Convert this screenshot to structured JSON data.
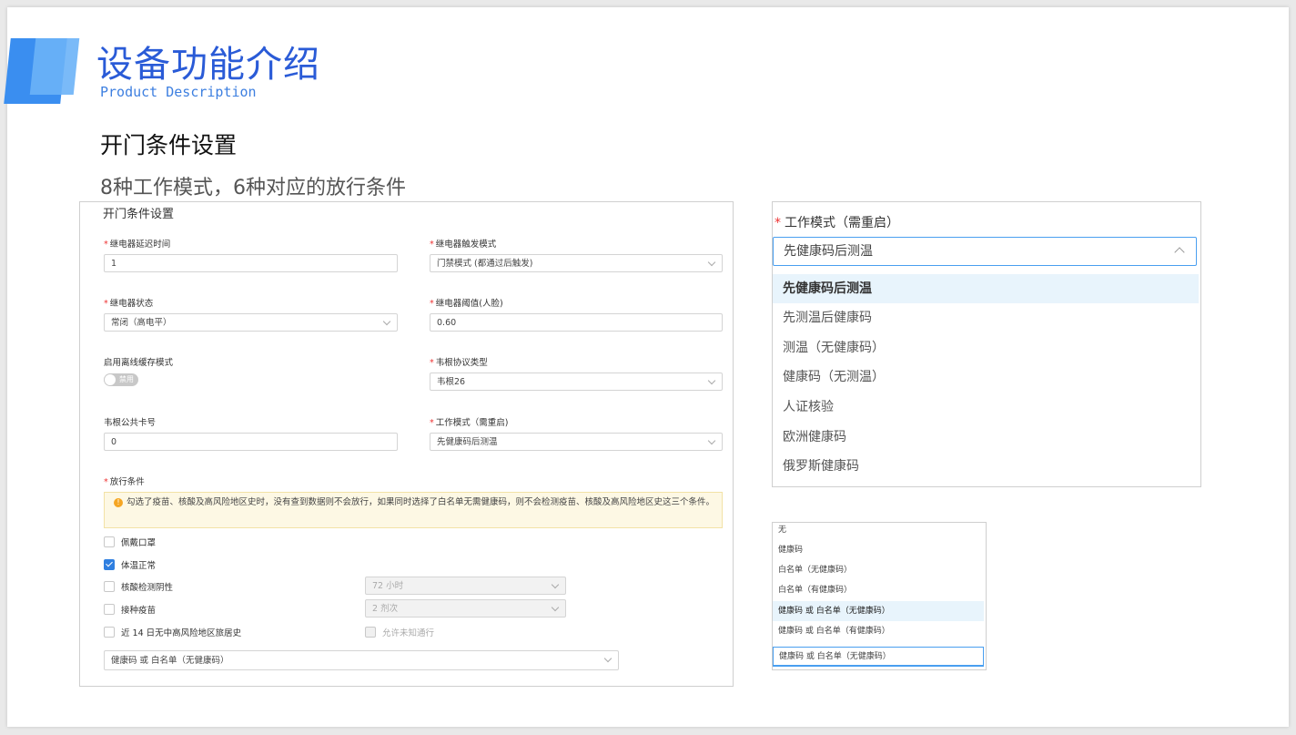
{
  "slide": {
    "title": "设备功能介绍",
    "subtitle": "Product Description",
    "heading": "开门条件设置",
    "subheading": "8种工作模式，6种对应的放行条件"
  },
  "form": {
    "title": "开门条件设置",
    "relay_delay": {
      "label": "继电器延迟时间",
      "value": "1"
    },
    "relay_trigger": {
      "label": "继电器触发模式",
      "value": "门禁模式 (都通过后触发)"
    },
    "relay_state": {
      "label": "继电器状态",
      "value": "常闭（高电平）"
    },
    "relay_threshold": {
      "label": "继电器阈值(人脸)",
      "value": "0.60"
    },
    "offline_cache": {
      "label": "启用离线缓存模式",
      "toggle_label": "禁用"
    },
    "wiegand_protocol": {
      "label": "韦根协议类型",
      "value": "韦根26"
    },
    "wiegand_card": {
      "label": "韦根公共卡号",
      "value": "0"
    },
    "work_mode": {
      "label": "工作模式（需重启",
      "value": "先健康码后测温"
    },
    "pass_conditions": {
      "label": "放行条件",
      "notice": "勾选了疫苗、核酸及高风险地区史时，没有查到数据则不会放行，如果同时选择了白名单无需健康码，则不会检测疫苗、核酸及高风险地区史这三个条件。",
      "mask": "佩戴口罩",
      "temp": "体温正常",
      "nucleic": "核酸检测阴性",
      "nucleic_value": "72 小时",
      "vaccine": "接种疫苗",
      "vaccine_value": "2 剂次",
      "travel": "近 14 日无中高风险地区旅居史",
      "allow_unknown": "允许未知通行",
      "health_select": "健康码 或 白名单（无健康码）"
    }
  },
  "work_mode_dropdown": {
    "label": "工作模式（需重启）",
    "selected": "先健康码后测温",
    "options": [
      "先健康码后测温",
      "先测温后健康码",
      "测温（无健康码）",
      "健康码（无测温）",
      "人证核验",
      "欧洲健康码",
      "俄罗斯健康码"
    ]
  },
  "pass_dropdown": {
    "options": [
      "无",
      "健康码",
      "白名单（无健康码）",
      "白名单（有健康码）",
      "健康码 或 白名单（无健康码）",
      "健康码 或 白名单（有健康码）"
    ],
    "selected": "健康码 或 白名单（无健康码）"
  },
  "colors": {
    "accent": "#2a5bd7",
    "selection_bg": "#e8f4fc",
    "required": "#e33333",
    "checkbox": "#2f7fe0"
  }
}
